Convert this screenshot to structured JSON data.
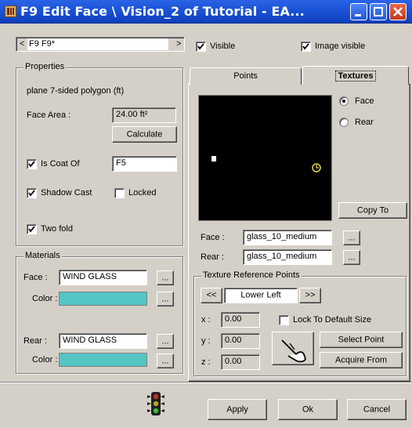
{
  "window": {
    "title": "F9 Edit Face \\ Vision_2 of Tutorial - EA...",
    "app_icon": "app-icon",
    "buttons": [
      "minimize-icon",
      "maximize-icon",
      "close-icon"
    ]
  },
  "top": {
    "prev_btn": "<",
    "next_btn": ">",
    "face_selector": "F9 F9*",
    "visible_label": "Visible",
    "visible_checked": true,
    "image_visible_label": "Image visible",
    "image_visible_checked": true
  },
  "properties": {
    "title": "Properties",
    "type_text": "plane  7-sided polygon  (ft)",
    "face_area_label": "Face Area :",
    "face_area_value": "24.00 ft²",
    "calculate_button": "Calculate",
    "is_coat_of_label": "Is Coat Of",
    "is_coat_of_checked": true,
    "is_coat_of_value": "F5",
    "shadow_cast_label": "Shadow Cast",
    "shadow_cast_checked": true,
    "locked_label": "Locked",
    "locked_checked": false,
    "two_fold_label": "Two fold",
    "two_fold_checked": true
  },
  "materials": {
    "title": "Materials",
    "face_label": "Face :",
    "face_value": "WIND GLASS",
    "face_color_label": "Color :",
    "rear_label": "Rear :",
    "rear_value": "WIND GLASS",
    "rear_color_label": "Color :",
    "browse_btn": "...",
    "swatch_color": "#53c5c4"
  },
  "tabs": {
    "points": "Points",
    "textures": "Textures",
    "active": "Textures"
  },
  "textures": {
    "face_radio": "Face",
    "rear_radio": "Rear",
    "selected_radio": "Face",
    "copy_to_button": "Copy To",
    "face_label": "Face :",
    "face_value": "glass_10_medium",
    "rear_label": "Rear :",
    "rear_value": "glass_10_medium",
    "browse_btn": "..."
  },
  "reference_points": {
    "title": "Texture Reference Points",
    "prev_btn": "<<",
    "next_btn": ">>",
    "current": "Lower Left",
    "x_label": "x :",
    "x_value": "0.00",
    "y_label": "y :",
    "y_value": "0.00",
    "z_label": "z :",
    "z_value": "0.00",
    "lock_label": "Lock To Default Size",
    "lock_checked": false,
    "select_point_button": "Select Point",
    "acquire_from_button": "Acquire From",
    "hand_icon": "pointing-hand-icon"
  },
  "footer": {
    "traffic_light_icon": "traffic-light-icon",
    "apply_button": "Apply",
    "ok_button": "Ok",
    "cancel_button": "Cancel"
  }
}
